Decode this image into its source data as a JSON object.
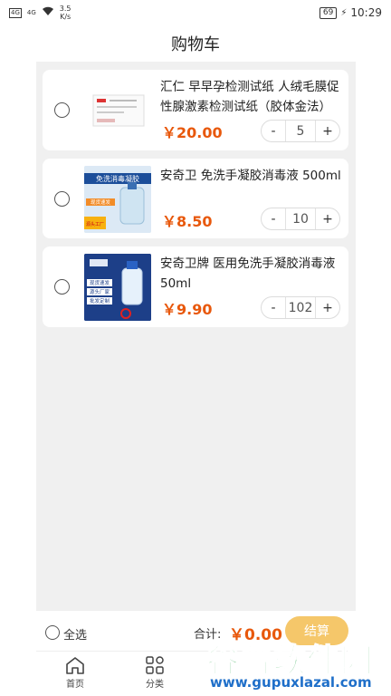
{
  "status_bar": {
    "signal": "4G",
    "net_indicator": "4G",
    "speed": "3.5",
    "speed_unit": "K/s",
    "battery": "69",
    "time": "10:29"
  },
  "header": {
    "title": "购物车"
  },
  "cart": {
    "items": [
      {
        "title": "汇仁 早早孕检测试纸 人绒毛膜促性腺激素检测试纸（胶体金法）2...",
        "price": "￥20.00",
        "quantity": "5",
        "minus": "-",
        "plus": "+"
      },
      {
        "title": "安奇卫 免洗手凝胶消毒液 500ml",
        "price": "￥8.50",
        "quantity": "10",
        "minus": "-",
        "plus": "+",
        "thumb_text": [
          "免洗消毒凝胶",
          "现货速发",
          "源头工厂"
        ]
      },
      {
        "title": "安奇卫牌 医用免洗手凝胶消毒液 50ml",
        "price": "￥9.90",
        "quantity": "102",
        "minus": "-",
        "plus": "+",
        "thumb_text": [
          "现货速发",
          "源头厂家",
          "批发定制"
        ]
      }
    ]
  },
  "bottom_bar": {
    "select_all": "全选",
    "total_label": "合计:",
    "total_value": "￥0.00",
    "checkout": "结算"
  },
  "tabs": [
    {
      "label": "首页",
      "icon": "home-icon"
    },
    {
      "label": "分类",
      "icon": "category-icon"
    }
  ],
  "watermark": {
    "text": "谷普软件园",
    "url": "www.gupuxlazal.com"
  },
  "colors": {
    "accent": "#e8580c",
    "checkout": "#f5c76a",
    "background": "#f0f0f0"
  }
}
